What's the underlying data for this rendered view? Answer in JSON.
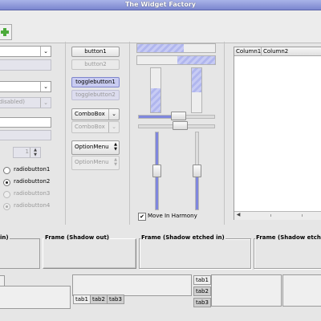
{
  "window": {
    "title": "The Widget Factory"
  },
  "left": {
    "disabled_combo_text": "(disabled)",
    "spinner_value": "1"
  },
  "buttons": {
    "button1": "button1",
    "button2": "button2",
    "toggle1": "togglebutton1",
    "toggle2": "togglebutton2",
    "combo1": "ComboBox",
    "combo2": "ComboBox",
    "option1": "OptionMenu",
    "option2": "OptionMenu"
  },
  "radios": [
    {
      "label": "radiobutton1",
      "checked": false,
      "enabled": true
    },
    {
      "label": "radiobutton2",
      "checked": true,
      "enabled": true
    },
    {
      "label": "radiobutton3",
      "checked": false,
      "enabled": false
    },
    {
      "label": "radiobutton4",
      "checked": true,
      "enabled": false
    }
  ],
  "sliders": {
    "move_in_harmony_label": "Move In Harmony",
    "move_in_harmony_checked": true
  },
  "tree": {
    "columns": [
      "Column1",
      "Column2"
    ]
  },
  "frames": [
    {
      "label": "in)"
    },
    {
      "label": "Frame (Shadow out)"
    },
    {
      "label": "Frame (Shadow etched in)"
    },
    {
      "label": "Frame (Shadow etche"
    }
  ],
  "notebooks": {
    "bottom_tabs": [
      "tab1",
      "tab2",
      "tab3"
    ],
    "side_tabs": [
      "tab1",
      "tab2",
      "tab3"
    ]
  },
  "icons": {
    "add": "add-icon",
    "dropdown": "chevron-down-icon",
    "spin": "spin-arrows-icon"
  }
}
